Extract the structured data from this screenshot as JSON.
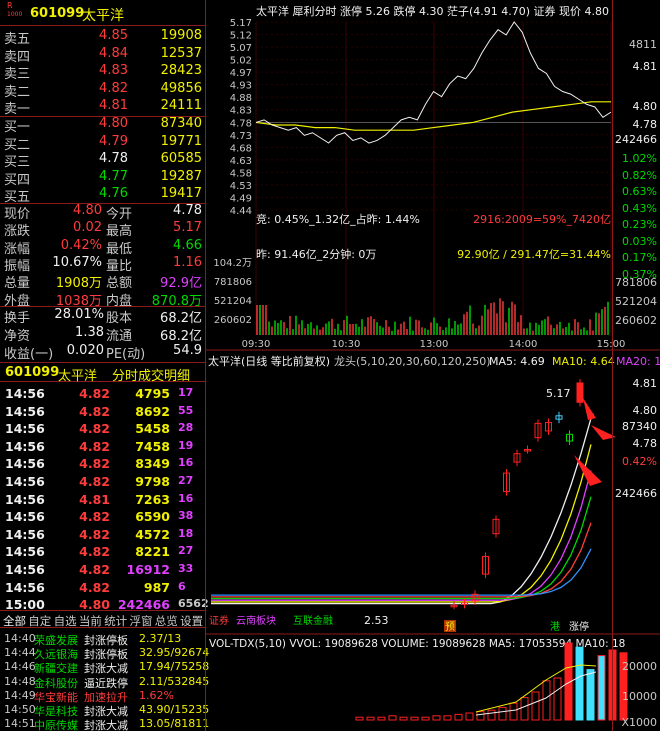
{
  "header": {
    "code": "601099",
    "name": "太平洋",
    "r_label": "R",
    "r_sub": "1000"
  },
  "sell": [
    {
      "label": "卖五",
      "price": "4.85",
      "vol": "19908"
    },
    {
      "label": "卖四",
      "price": "4.84",
      "vol": "12537"
    },
    {
      "label": "卖三",
      "price": "4.83",
      "vol": "28423"
    },
    {
      "label": "卖二",
      "price": "4.82",
      "vol": "49856"
    },
    {
      "label": "卖一",
      "price": "4.81",
      "vol": "24111"
    }
  ],
  "buy": [
    {
      "label": "买一",
      "price": "4.80",
      "vol": "87340"
    },
    {
      "label": "买二",
      "price": "4.79",
      "vol": "19771"
    },
    {
      "label": "买三",
      "price": "4.78",
      "vol": "60585"
    },
    {
      "label": "买四",
      "price": "4.77",
      "vol": "19287"
    },
    {
      "label": "买五",
      "price": "4.76",
      "vol": "19417"
    }
  ],
  "quote": [
    {
      "l1": "现价",
      "v1": "4.80",
      "l2": "今开",
      "v2": "4.78"
    },
    {
      "l1": "涨跌",
      "v1": "0.02",
      "l2": "最高",
      "v2": "5.17"
    },
    {
      "l1": "涨幅",
      "v1": "0.42%",
      "l2": "最低",
      "v2": "4.66"
    },
    {
      "l1": "振幅",
      "v1": "10.67%",
      "l2": "量比",
      "v2": "1.16"
    },
    {
      "l1": "总量",
      "v1": "1908万",
      "l2": "总额",
      "v2": "92.9亿"
    },
    {
      "l1": "外盘",
      "v1": "1038万",
      "l2": "内盘",
      "v2": "870.8万"
    }
  ],
  "quote2": [
    {
      "l1": "换手",
      "v1": "28.01%",
      "l2": "股本",
      "v2": "68.2亿"
    },
    {
      "l1": "净资",
      "v1": "1.38",
      "l2": "流通",
      "v2": "68.2亿"
    },
    {
      "l1": "收益(一)",
      "v1": "0.020",
      "l2": "PE(动)",
      "v2": "54.9"
    }
  ],
  "tick_title": {
    "code": "601099",
    "name": "太平洋",
    "title": "分时成交明细"
  },
  "ticks": [
    {
      "t": "14:56",
      "p": "4.82",
      "v": "4795",
      "n": "17"
    },
    {
      "t": "14:56",
      "p": "4.82",
      "v": "8692",
      "n": "55"
    },
    {
      "t": "14:56",
      "p": "4.82",
      "v": "5458",
      "n": "28"
    },
    {
      "t": "14:56",
      "p": "4.82",
      "v": "7458",
      "n": "19"
    },
    {
      "t": "14:56",
      "p": "4.82",
      "v": "8349",
      "n": "16"
    },
    {
      "t": "14:56",
      "p": "4.82",
      "v": "9798",
      "n": "27"
    },
    {
      "t": "14:56",
      "p": "4.81",
      "v": "7263",
      "n": "16"
    },
    {
      "t": "14:56",
      "p": "4.82",
      "v": "6590",
      "n": "38"
    },
    {
      "t": "14:56",
      "p": "4.82",
      "v": "4572",
      "n": "18"
    },
    {
      "t": "14:56",
      "p": "4.82",
      "v": "8221",
      "n": "27"
    },
    {
      "t": "14:56",
      "p": "4.82",
      "v": "16912",
      "n": "33"
    },
    {
      "t": "14:56",
      "p": "4.82",
      "v": "987",
      "n": "6"
    },
    {
      "t": "15:00",
      "p": "4.80",
      "v": "242466",
      "n": "6562"
    }
  ],
  "tabs": [
    "全部",
    "自定",
    "自选",
    "当前",
    "统计",
    "浮窗",
    "总览",
    "设置"
  ],
  "news": [
    {
      "t": "14:40",
      "n": "荣盛发展",
      "s": "封涨停板",
      "v": "2.37/13"
    },
    {
      "t": "14:44",
      "n": "久远银海",
      "s": "封涨停板",
      "v": "32.95/92674"
    },
    {
      "t": "14:46",
      "n": "新疆交建",
      "s": "封涨大减",
      "v": "17.94/75258"
    },
    {
      "t": "14:48",
      "n": "金科股份",
      "s": "逼近跌停",
      "v": "2.11/532845"
    },
    {
      "t": "14:49",
      "n": "华宝新能",
      "s": "加速拉升",
      "v": "1.62%"
    },
    {
      "t": "14:50",
      "n": "华是科技",
      "s": "封涨大减",
      "v": "43.90/15235"
    },
    {
      "t": "14:51",
      "n": "中原传媒",
      "s": "封涨大减",
      "v": "13.05/81811"
    }
  ],
  "intraday": {
    "title": "太平洋  犀利分时  涨停 5.26  跌停 4.30  茫子(4.91  4.70)  证券  现价 4.80",
    "y_ticks": [
      "5.17",
      "5.12",
      "5.07",
      "5.02",
      "4.97",
      "4.93",
      "4.88",
      "4.83",
      "4.78",
      "4.73",
      "4.68",
      "4.63",
      "4.58",
      "4.53",
      "4.49",
      "4.44"
    ],
    "auction_text": "竞: 0.45%_1.32亿_占昨: 1.44%",
    "auction_right": "2916:2009=59%_7420亿",
    "yesterday_text": "昨: 91.46亿_2分钟: 0万",
    "yesterday_right": "92.90亿 / 291.47亿=31.44%",
    "vol_ticks": [
      "104.2万",
      "781806",
      "521204",
      "260602"
    ],
    "x_ticks": [
      "09:30",
      "10:30",
      "13:00",
      "14:00",
      "15:00"
    ],
    "right_ticks": [
      "4811",
      "4.81",
      "4.80",
      "4.78",
      "242466"
    ],
    "pct_ticks": [
      "1.02%",
      "0.82%",
      "0.63%",
      "0.43%",
      "0.23%",
      "0.03%",
      "0.17%",
      "0.37%"
    ],
    "sidebar_vol": [
      "781806",
      "521204",
      "260602"
    ]
  },
  "daily": {
    "title": "太平洋(日线 等比前复权)",
    "ma_label": "龙头(5,10,20,30,60,120,250)",
    "ma5": "MA5: 4.69",
    "ma10": "MA10: 4.64",
    "ma20": "MA20: 18",
    "high_label": "5.17",
    "low_label": "2.53",
    "right": [
      "4.81",
      "4.80",
      "87340",
      "4.78",
      "0.42%",
      "242466"
    ],
    "bottom_labels": [
      "证券",
      "云南板块",
      "互联金融"
    ],
    "markers": [
      "预",
      "港",
      "涨停"
    ]
  },
  "volume": {
    "title": "VOL-TDX(5,10)  VVOL: 19089628  VOLUME: 19089628  MA5: 17053594  MA10: 18",
    "ticks": [
      "20000",
      "10000",
      "X1000"
    ]
  },
  "chart_data": {
    "type": "line",
    "intraday_price": [
      4.78,
      4.79,
      4.77,
      4.76,
      4.75,
      4.76,
      4.73,
      4.74,
      4.72,
      4.7,
      4.73,
      4.74,
      4.71,
      4.72,
      4.7,
      4.71,
      4.73,
      4.76,
      4.79,
      4.8,
      4.79,
      4.85,
      4.9,
      4.88,
      4.93,
      4.96,
      4.95,
      4.99,
      5.05,
      5.1,
      5.14,
      5.12,
      5.17,
      5.13,
      5.05,
      4.99,
      4.97,
      4.92,
      4.9,
      4.89,
      4.87,
      4.85,
      4.84,
      4.8,
      4.82
    ],
    "avg_price": [
      4.78,
      4.77,
      4.77,
      4.76,
      4.76,
      4.75,
      4.75,
      4.75,
      4.75,
      4.76,
      4.77,
      4.78,
      4.8,
      4.82,
      4.83,
      4.84,
      4.85,
      4.86,
      4.86
    ],
    "daily_candles": [
      {
        "o": 2.53,
        "c": 2.53
      },
      {
        "o": 2.54,
        "c": 2.56
      },
      {
        "o": 2.58,
        "c": 2.66
      },
      {
        "o": 2.9,
        "c": 3.11
      },
      {
        "o": 3.38,
        "c": 3.55
      },
      {
        "o": 3.88,
        "c": 4.1
      },
      {
        "o": 4.23,
        "c": 4.33
      },
      {
        "o": 4.38,
        "c": 4.38
      },
      {
        "o": 4.52,
        "c": 4.69
      },
      {
        "o": 4.6,
        "c": 4.7
      },
      {
        "o": 4.74,
        "c": 4.78
      },
      {
        "o": 4.56,
        "c": 4.48
      },
      {
        "o": 4.94,
        "c": 5.17
      },
      {
        "o": 4.78,
        "c": 4.8
      }
    ]
  }
}
